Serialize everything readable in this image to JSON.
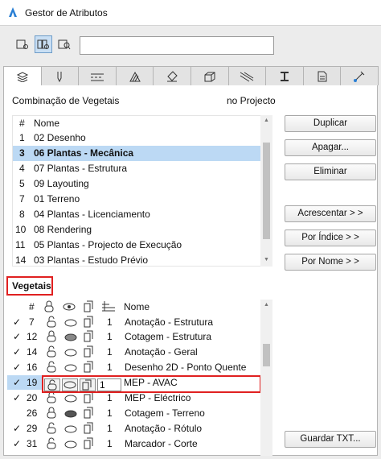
{
  "window": {
    "title": "Gestor de Atributos"
  },
  "search": {
    "value": ""
  },
  "view_buttons": [
    "list-view",
    "split-view",
    "detail-view"
  ],
  "tabs": [
    "layers",
    "pens",
    "fills",
    "surfaces",
    "materials",
    "composites",
    "profiles",
    "zones",
    "markers",
    "graphisoft"
  ],
  "combination": {
    "label": "Combinação de Vegetais",
    "location": "no Projecto"
  },
  "layer_combos": {
    "headers": [
      "#",
      "Nome"
    ],
    "rows": [
      {
        "num": "1",
        "name": "02 Desenho"
      },
      {
        "num": "3",
        "name": "06 Plantas - Mecânica"
      },
      {
        "num": "4",
        "name": "07 Plantas - Estrutura"
      },
      {
        "num": "5",
        "name": "09 Layouting"
      },
      {
        "num": "7",
        "name": "01 Terreno"
      },
      {
        "num": "8",
        "name": "04 Plantas - Licenciamento"
      },
      {
        "num": "10",
        "name": "08 Rendering"
      },
      {
        "num": "11",
        "name": "05 Plantas - Projecto de Execução"
      },
      {
        "num": "14",
        "name": "03 Plantas - Estudo Prévio"
      }
    ]
  },
  "buttons": {
    "duplicar": "Duplicar",
    "apagar": "Apagar...",
    "eliminar": "Eliminar",
    "acrescentar": "Acrescentar > >",
    "por_indice": "Por Índice > >",
    "por_nome": "Por Nome > >",
    "guardar": "Guardar TXT..."
  },
  "vegetais": {
    "label": "Vegetais",
    "headers": [
      "#",
      "Nome"
    ],
    "rows": [
      {
        "check": "✓",
        "num": "7",
        "pen": "1",
        "name": "Anotação - Estrutura"
      },
      {
        "check": "✓",
        "num": "12",
        "pen": "1",
        "name": "Cotagem - Estrutura"
      },
      {
        "check": "✓",
        "num": "14",
        "pen": "1",
        "name": "Anotação - Geral"
      },
      {
        "check": "✓",
        "num": "16",
        "pen": "1",
        "name": "Desenho 2D - Ponto Quente"
      },
      {
        "check": "✓",
        "num": "19",
        "pen": "1",
        "name": "MEP - AVAC"
      },
      {
        "check": "✓",
        "num": "20",
        "pen": "1",
        "name": "MEP - Eléctrico"
      },
      {
        "check": "",
        "num": "26",
        "pen": "1",
        "name": "Cotagem - Terreno"
      },
      {
        "check": "✓",
        "num": "29",
        "pen": "1",
        "name": "Anotação - Rótulo"
      },
      {
        "check": "✓",
        "num": "31",
        "pen": "1",
        "name": "Marcador - Corte"
      }
    ]
  },
  "colors": {
    "accent": "#bcd9f4",
    "highlight": "#e02020"
  }
}
